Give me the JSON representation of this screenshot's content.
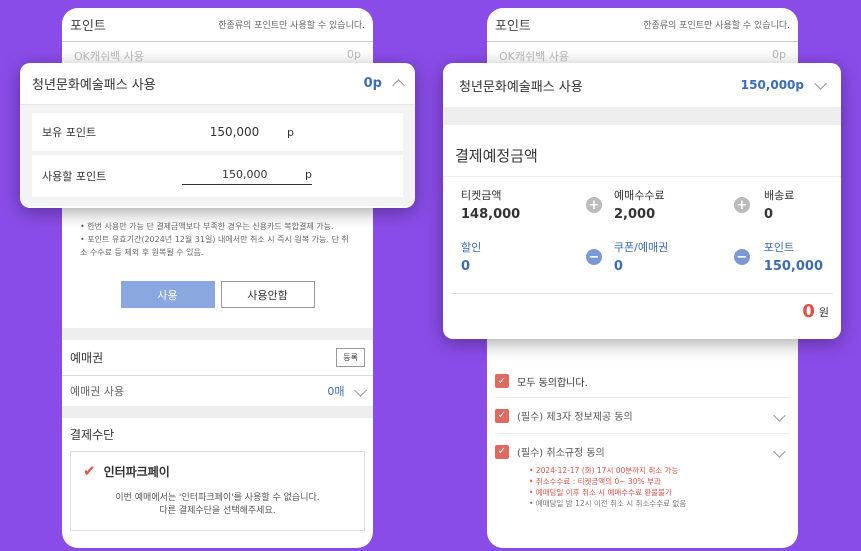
{
  "left": {
    "point_section": {
      "title": "포인트",
      "note": "한종류의 포인트만 사용할 수 있습니다."
    },
    "ok_cashbag": {
      "label": "OK캐쉬백 사용",
      "value": "0p"
    },
    "notes": [
      "• 한번 사용만 가능 단 결제금액보다 부족한 경우는 신용카드 복합결제 가능.",
      "• 포인트 유효기간(2024년 12월 31일) 내에서만 취소 시 즉시 원복 가능. 단 취소 수수료 등 제외 후 원복될 수 있음."
    ],
    "use_button": "사용",
    "no_use_button": "사용안함",
    "voucher": {
      "title": "예매권",
      "reg_button": "등록",
      "use_label": "예매권 사용",
      "value": "0매"
    },
    "payment": {
      "title": "결제수단",
      "method": "인터파크페이",
      "msg1": "이번 예매에서는 '인터파크페이'를 사용할 수 없습니다.",
      "msg2": "다른 결제수단을 선택해주세요."
    }
  },
  "left_card": {
    "title": "청년문화예술패스 사용",
    "value": "0p",
    "held_label": "보유 포인트",
    "held_value": "150,000",
    "held_unit": "p",
    "use_label": "사용할 포인트",
    "use_value": "150,000",
    "use_unit": "p"
  },
  "right": {
    "point_section": {
      "title": "포인트",
      "note": "한종류의 포인트만 사용할 수 있습니다."
    },
    "ok_cashbag": {
      "label": "OK캐쉬백 사용",
      "value": "0p"
    },
    "agree_all": "모두 동의합니다.",
    "agree1": "(필수) 제3자 정보제공 동의",
    "agree2": "(필수) 취소규정 동의",
    "cancel_notes": [
      "• 2024-12-17 (화) 17시 00분까지 취소 가능",
      "• 취소수수료 : 티켓금액의 0~ 30% 부과",
      "• 예매당일 이후 취소 시 예매수수료 환불불가",
      "• 예매당일 밤 12시 이전 취소 시 취소수수료 없음"
    ]
  },
  "right_card": {
    "title": "청년문화예술패스 사용",
    "value": "150,000p",
    "summary_title": "결제예정금액",
    "ticket_label": "티켓금액",
    "ticket_value": "148,000",
    "fee_label": "예매수수료",
    "fee_value": "2,000",
    "delivery_label": "배송료",
    "delivery_value": "0",
    "discount_label": "할인",
    "discount_value": "0",
    "coupon_label": "쿠폰/예매권",
    "coupon_value": "0",
    "point_label": "포인트",
    "point_value": "150,000",
    "total_value": "0",
    "total_unit": "원"
  },
  "colors": {
    "bg": "#8a4ce8",
    "accent_blue": "#3d6bb8",
    "red": "#e2504a"
  }
}
